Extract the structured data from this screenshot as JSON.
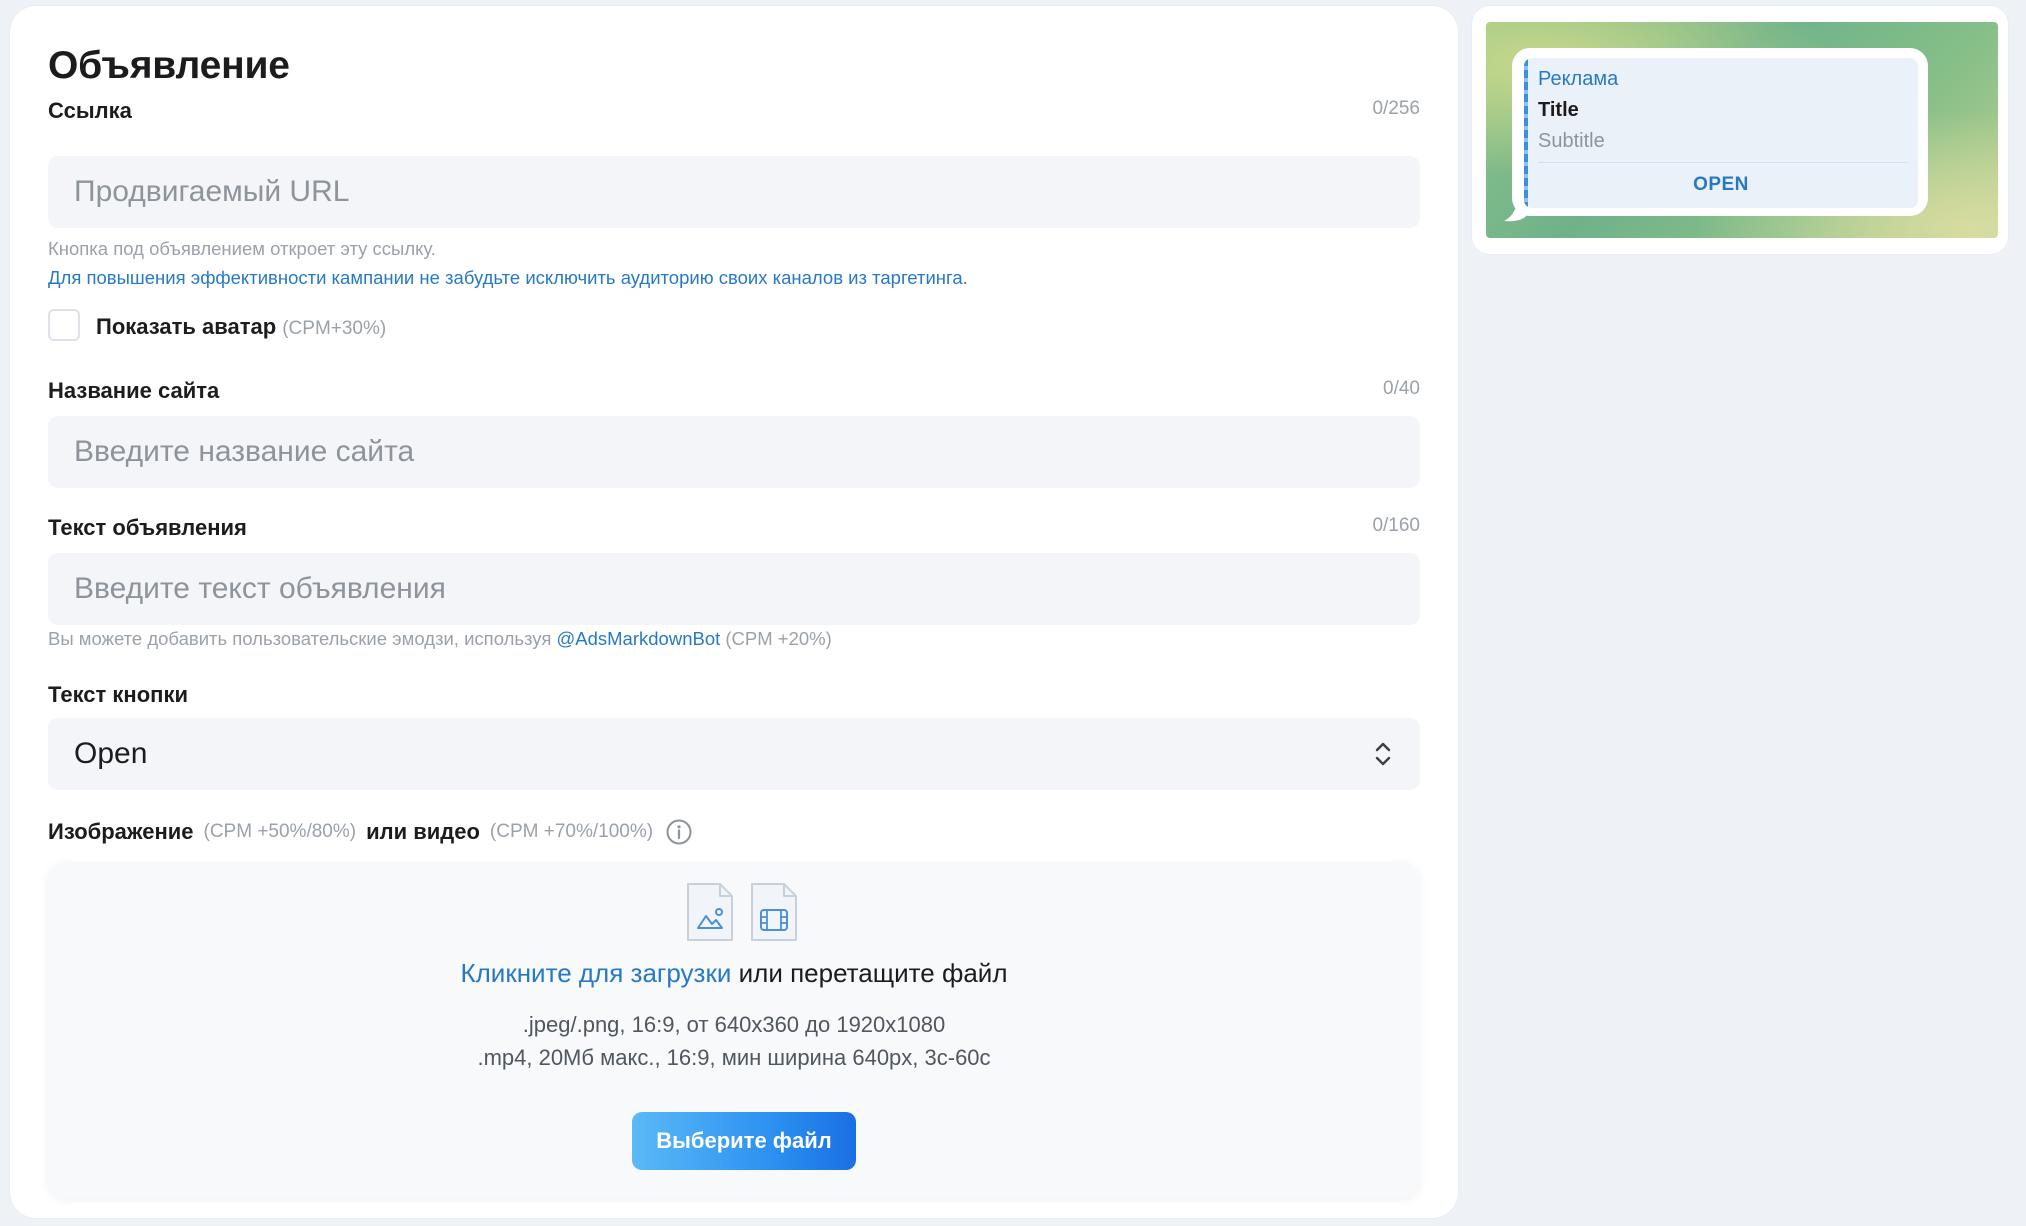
{
  "form": {
    "title": "Объявление",
    "link": {
      "label": "Ссылка",
      "counter": "0/256",
      "placeholder": "Продвигаемый URL",
      "hint": "Кнопка под объявлением откроет эту ссылку.",
      "hint_blue": "Для повышения эффективности кампании не забудьте исключить аудиторию своих каналов из таргетинга."
    },
    "avatar": {
      "label": "Показать аватар",
      "note": "(CPM+30%)",
      "checked": false
    },
    "site_name": {
      "label": "Название сайта",
      "counter": "0/40",
      "placeholder": "Введите название сайта"
    },
    "ad_text": {
      "label": "Текст объявления",
      "counter": "0/160",
      "placeholder": "Введите текст объявления",
      "hint_prefix": "Вы можете добавить пользовательские эмодзи, используя",
      "hint_link": "@AdsMarkdownBot",
      "hint_suffix": "(CPM +20%)"
    },
    "button_text": {
      "label": "Текст кнопки",
      "value": "Open"
    },
    "media": {
      "label_image": "Изображение",
      "image_note": "(CPM +50%/80%)",
      "label_or_video": "или видео",
      "video_note": "(CPM +70%/100%)",
      "upload_link": "Кликните для загрузки",
      "upload_rest": "или перетащите файл",
      "image_specs": ".jpeg/.png, 16:9, от 640x360 до 1920x1080",
      "video_specs": ".mp4, 20Мб макс., 16:9, мин ширина 640px, 3с-60с",
      "choose_button": "Выберите файл",
      "icons": [
        "image-file-icon",
        "video-file-icon"
      ]
    }
  },
  "preview": {
    "sponsor_label": "Реклама",
    "title": "Title",
    "subtitle": "Subtitle",
    "open_label": "OPEN"
  },
  "colors": {
    "accent": "#2779c4",
    "input_bg": "#f3f5f8",
    "muted": "#9aa1a9",
    "button_gradient_start": "#5bb9f6",
    "button_gradient_end": "#1a6fe3"
  }
}
